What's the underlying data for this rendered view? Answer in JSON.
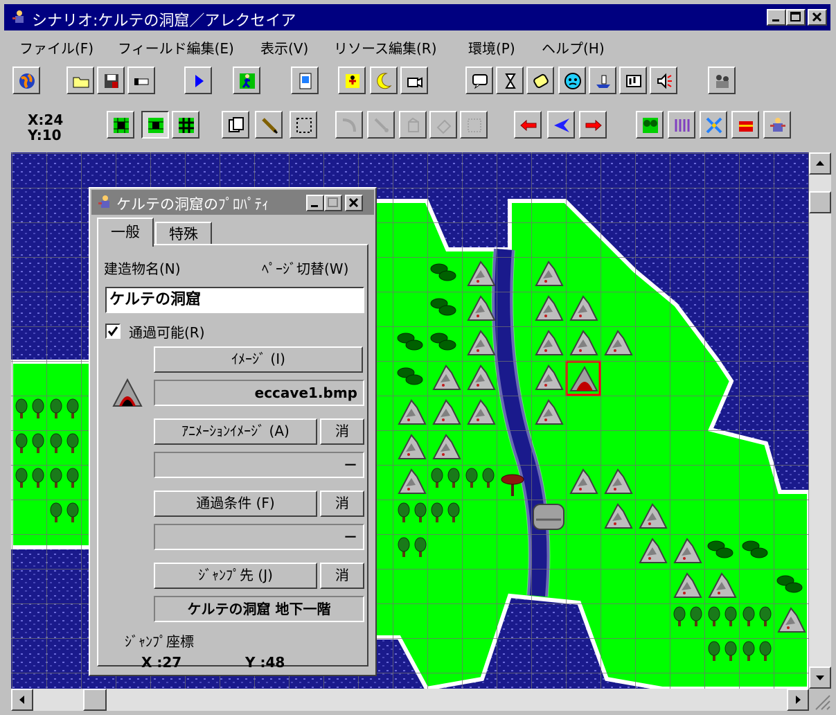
{
  "window": {
    "title": "シナリオ:ケルテの洞窟／アレクセイア"
  },
  "menu": [
    {
      "label": "ファイル(F)"
    },
    {
      "label": "フィールド編集(E)"
    },
    {
      "label": "表示(V)"
    },
    {
      "label": "リソース編集(R)"
    },
    {
      "label": "環境(P)"
    },
    {
      "label": "ヘルプ(H)"
    }
  ],
  "toolbar": {
    "row1_icons": [
      "globe-icon",
      "folder-open-icon",
      "save-icon",
      "hand-pointer-icon",
      "play-icon",
      "walking-man-icon",
      "document-icon",
      "dancer-icon",
      "moon-icon",
      "camera-icon",
      "speech-icon",
      "hourglass-icon",
      "scroll-icon",
      "face-icon",
      "boat-icon",
      "music-icon",
      "speaker-icon",
      "party-icon"
    ],
    "row2_icons": [
      "grid-mode-1-icon",
      "grid-mode-2-icon",
      "grid-mode-3-icon",
      "stamp-icon",
      "pencil-icon",
      "select-rect-icon",
      "curve-icon",
      "brush-icon",
      "fill-icon",
      "eraser-icon",
      "paste-icon",
      "arrow-left-icon",
      "arrow-back-icon",
      "arrow-right-icon",
      "forest-icon",
      "fence-icon",
      "sword-icon",
      "treasure-icon",
      "character-icon"
    ]
  },
  "cursor": {
    "x_label": "X:24",
    "y_label": "Y:10"
  },
  "dialog": {
    "title": "ケルテの洞窟のﾌﾟﾛﾊﾟﾃｨ",
    "tabs": [
      {
        "label": "一般"
      },
      {
        "label": "特殊"
      }
    ],
    "name_label": "建造物名(N)",
    "page_switch_label": "ﾍﾟｰｼﾞ切替(W)",
    "name_value": "ケルテの洞窟",
    "passable_label": "通過可能(R)",
    "passable_checked": true,
    "image_button": "ｲﾒｰｼﾞ (I)",
    "image_file": "eccave1.bmp",
    "anim_button": "ｱﾆﾒｰｼｮﾝｲﾒｰｼﾞ (A)",
    "anim_value": "－",
    "condition_button": "通過条件 (F)",
    "condition_value": "－",
    "jump_button": "ｼﾞｬﾝﾌﾟ先 (J)",
    "jump_value": "ケルテの洞窟 地下一階",
    "clear_label": "消",
    "jump_coords_label": "ｼﾞｬﾝﾌﾟ座標",
    "jump_x_label": "X :27",
    "jump_y_label": "Y :48"
  },
  "colors": {
    "title_active": "#000080",
    "title_inactive": "#808080",
    "water": "#1a1a8c",
    "grass": "#00ff00",
    "selection": "#ff0000"
  }
}
